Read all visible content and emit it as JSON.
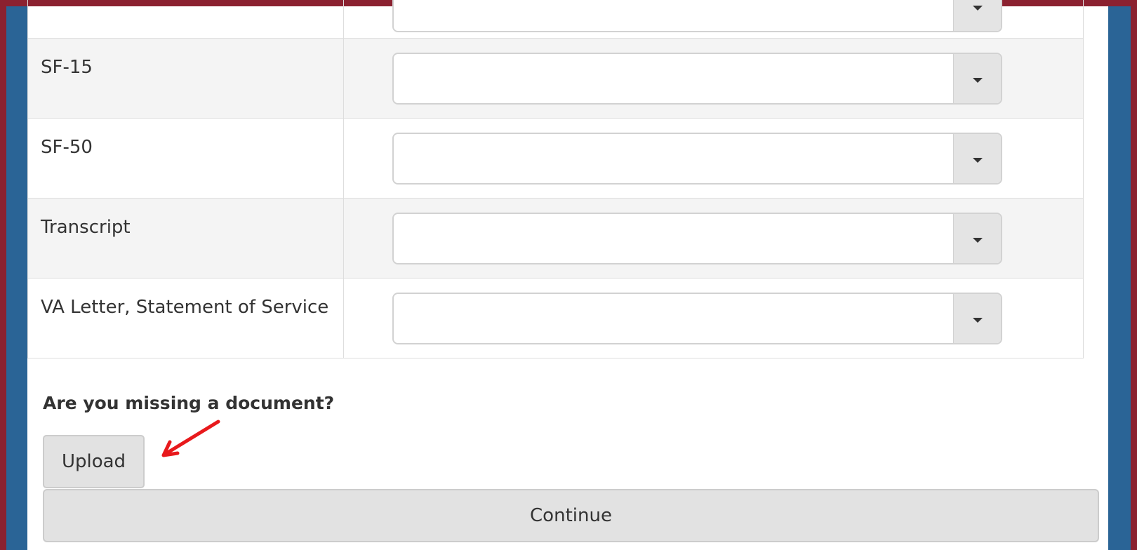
{
  "documents": {
    "rows": [
      {
        "label": "",
        "selected": ""
      },
      {
        "label": "SF-15",
        "selected": ""
      },
      {
        "label": "SF-50",
        "selected": ""
      },
      {
        "label": "Transcript",
        "selected": ""
      },
      {
        "label": "VA Letter, Statement of Service",
        "selected": ""
      }
    ]
  },
  "missing": {
    "title": "Are you missing a document?",
    "upload_label": "Upload"
  },
  "continue_label": "Continue",
  "colors": {
    "frame_border": "#8b2130",
    "background_blue": "#2a6496",
    "annotation_arrow": "#e8191c"
  }
}
